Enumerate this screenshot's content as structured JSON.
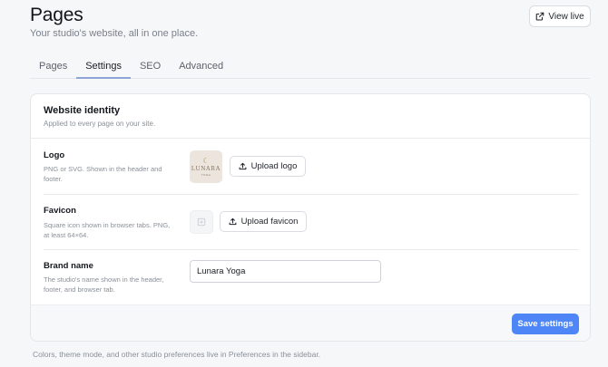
{
  "header": {
    "title": "Pages",
    "subtitle": "Your studio's website, all in one place.",
    "view_live_label": "View live"
  },
  "tabs": [
    {
      "label": "Pages",
      "active": false
    },
    {
      "label": "Settings",
      "active": true
    },
    {
      "label": "SEO",
      "active": false
    },
    {
      "label": "Advanced",
      "active": false
    }
  ],
  "card": {
    "title": "Website identity",
    "subtitle": "Applied to every page on your site.",
    "logo": {
      "label": "Logo",
      "help": "PNG or SVG. Shown in the header and footer.",
      "thumb_word": "LUNARA",
      "thumb_tag": "YOGA",
      "button_label": "Upload logo"
    },
    "favicon": {
      "label": "Favicon",
      "help": "Square icon shown in browser tabs. PNG, at least 64×64.",
      "button_label": "Upload favicon"
    },
    "brand": {
      "label": "Brand name",
      "help": "The studio's name shown in the header, footer, and browser tab.",
      "value": "Lunara Yoga"
    },
    "save_label": "Save settings"
  },
  "footnote": "Colors, theme mode, and other studio preferences live in Preferences in the sidebar.",
  "colors": {
    "accent": "#4f86f7",
    "tab_indicator": "#8ea3d6",
    "background": "#f6f7f9"
  }
}
